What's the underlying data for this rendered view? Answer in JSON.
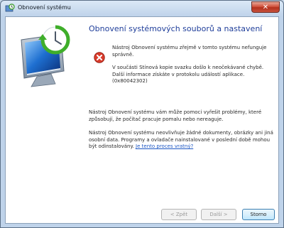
{
  "window": {
    "title": "Obnovení systému",
    "close_glyph": "✕",
    "heading": "Obnovení systémových souborů a nastavení"
  },
  "error": {
    "line1": "Nástroj Obnovení systému zřejmě v tomto systému nefunguje správně.",
    "line2": "V součásti Stínová kopie svazku došlo k neočekávané chybě. Další informace získáte v protokolu událostí aplikace.",
    "code": "(0x80042302)"
  },
  "body": {
    "para1": "Nástroj Obnovení systému vám může pomoci vyřešit problémy, které způsobují, že počítač pracuje pomalu nebo nereaguje.",
    "para2": "Nástroj Obnovení systému neovlivňuje žádné dokumenty, obrázky ani jiná osobní data. Programy a ovladače nainstalované v poslední době mohou být odinstalovány.",
    "link": "Je tento proces vratný?"
  },
  "buttons": {
    "back": "< Zpět",
    "next": "Další >",
    "cancel": "Storno"
  },
  "icons": {
    "title": "system-restore-icon",
    "hero": "system-restore-monitor-icon",
    "error": "error-icon",
    "close": "close-icon"
  },
  "colors": {
    "heading": "#1f3e9a",
    "link": "#1d57c4",
    "error": "#d93b2b"
  }
}
